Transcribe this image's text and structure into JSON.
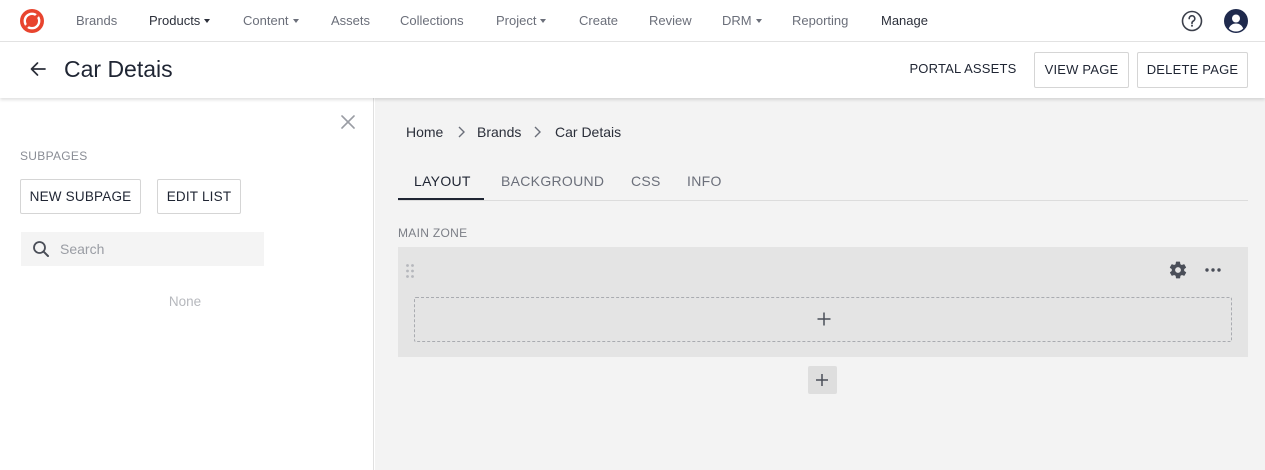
{
  "nav": {
    "items": [
      {
        "label": "Brands",
        "dropdown": false
      },
      {
        "label": "Products",
        "dropdown": true
      },
      {
        "label": "Content",
        "dropdown": true
      },
      {
        "label": "Assets",
        "dropdown": false
      },
      {
        "label": "Collections",
        "dropdown": false
      },
      {
        "label": "Project",
        "dropdown": true
      },
      {
        "label": "Create",
        "dropdown": false
      },
      {
        "label": "Review",
        "dropdown": false
      },
      {
        "label": "DRM",
        "dropdown": true
      },
      {
        "label": "Reporting",
        "dropdown": false
      },
      {
        "label": "Manage",
        "dropdown": false
      }
    ],
    "icons": {
      "logo": "brand-logo-icon",
      "help": "help-circle-icon",
      "account": "user-avatar-icon"
    }
  },
  "header": {
    "title": "Car Detais",
    "portal_assets_label": "PORTAL ASSETS",
    "view_page_label": "VIEW PAGE",
    "delete_page_label": "DELETE PAGE"
  },
  "sidebar": {
    "section_label": "SUBPAGES",
    "new_subpage_label": "NEW SUBPAGE",
    "edit_list_label": "EDIT LIST",
    "search_placeholder": "Search",
    "empty_text": "None"
  },
  "main": {
    "breadcrumb": [
      "Home",
      "Brands",
      "Car Detais"
    ],
    "tabs": [
      {
        "label": "LAYOUT",
        "active": true
      },
      {
        "label": "BACKGROUND",
        "active": false
      },
      {
        "label": "CSS",
        "active": false
      },
      {
        "label": "INFO",
        "active": false
      }
    ],
    "zone_label": "MAIN ZONE"
  },
  "colors": {
    "brand": "#e8442e",
    "text_dark": "#1f2533",
    "text_muted": "#6b6f7a",
    "panel_bg": "#f3f3f3",
    "zone_bg": "#e4e4e4"
  }
}
